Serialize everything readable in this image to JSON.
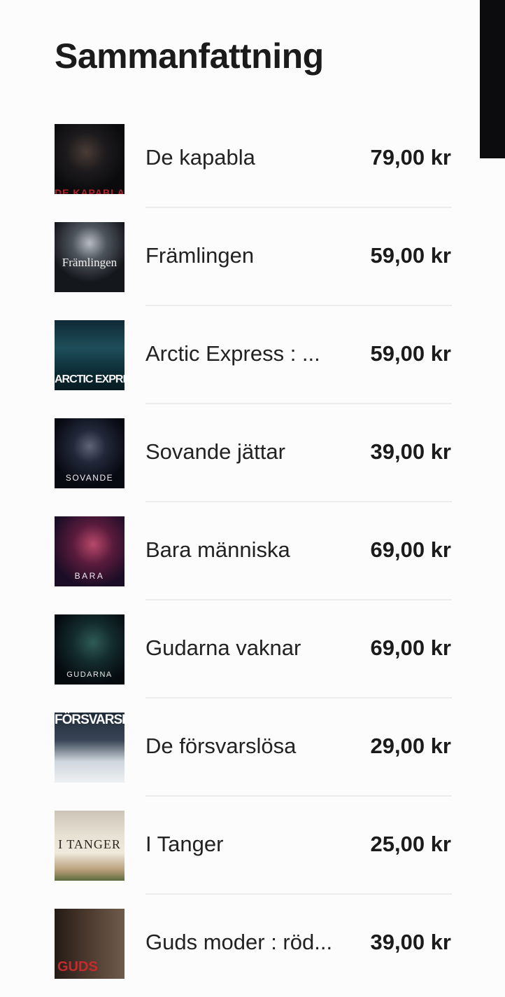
{
  "summary": {
    "heading": "Sammanfattning",
    "items": [
      {
        "title": "De kapabla",
        "price": "79,00 kr",
        "cover_text": "DE KAPABLA"
      },
      {
        "title": "Främlingen",
        "price": "59,00 kr",
        "cover_text": "Främlingen"
      },
      {
        "title": "Arctic Express : ...",
        "price": "59,00 kr",
        "cover_text": "ARCTIC EXPRESS"
      },
      {
        "title": "Sovande jättar",
        "price": "39,00 kr",
        "cover_text": "SOVANDE"
      },
      {
        "title": "Bara människa",
        "price": "69,00 kr",
        "cover_text": "BARA"
      },
      {
        "title": "Gudarna vaknar",
        "price": "69,00 kr",
        "cover_text": "GUDARNA"
      },
      {
        "title": "De försvarslösa",
        "price": "29,00 kr",
        "cover_text": "FÖRSVARSLÖSA"
      },
      {
        "title": "I Tanger",
        "price": "25,00 kr",
        "cover_text": "I TANGER"
      },
      {
        "title": "Guds moder : röd...",
        "price": "39,00 kr",
        "cover_text": "GUDS"
      }
    ]
  }
}
